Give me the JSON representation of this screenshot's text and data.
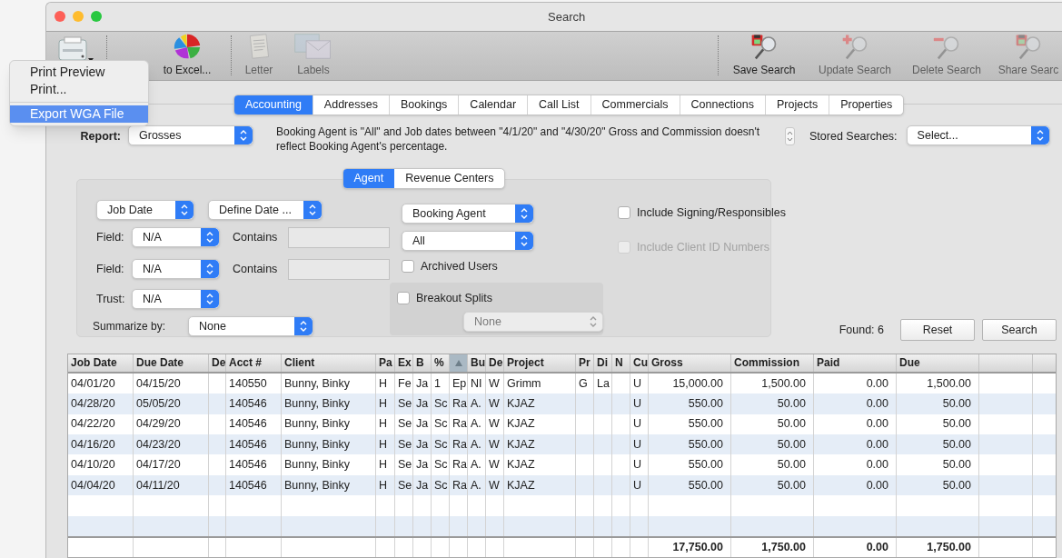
{
  "window": {
    "title": "Search"
  },
  "toolbar": {
    "left": [
      {
        "kind": "printer",
        "has_menu": true
      },
      {
        "kind": "pie-chart",
        "label": "to Excel...",
        "disabled": false
      },
      {
        "kind": "letter",
        "label": "Letter",
        "disabled": true
      },
      {
        "kind": "labels",
        "label": "Labels",
        "disabled": true
      }
    ],
    "right": [
      {
        "kind": "save",
        "label": "Save Search",
        "disabled": false
      },
      {
        "kind": "update",
        "label": "Update Search",
        "disabled": true
      },
      {
        "kind": "delete",
        "label": "Delete Search",
        "disabled": true
      },
      {
        "kind": "share",
        "label": "Share Searc",
        "disabled": true
      }
    ]
  },
  "print_menu": {
    "items": [
      {
        "label": "Print Preview",
        "selected": false
      },
      {
        "label": "Print...",
        "selected": false
      },
      {
        "label": "Export WGA File",
        "selected": true
      }
    ]
  },
  "tabs": [
    {
      "label": "Accounting",
      "selected": true
    },
    {
      "label": "Addresses",
      "selected": false
    },
    {
      "label": "Bookings",
      "selected": false
    },
    {
      "label": "Calendar",
      "selected": false
    },
    {
      "label": "Call List",
      "selected": false
    },
    {
      "label": "Commercials",
      "selected": false
    },
    {
      "label": "Connections",
      "selected": false
    },
    {
      "label": "Projects",
      "selected": false
    },
    {
      "label": "Properties",
      "selected": false
    }
  ],
  "report": {
    "label": "Report:",
    "value": "Grosses"
  },
  "description": "Booking Agent is \"All\" and Job dates between \"4/1/20\" and \"4/30/20\" Gross and Commission doesn't reflect Booking Agent's percentage.",
  "stored_searches": {
    "label": "Stored Searches:",
    "value": "Select..."
  },
  "criteria": {
    "tabs": [
      {
        "label": "Agent",
        "selected": true
      },
      {
        "label": "Revenue Centers",
        "selected": false
      }
    ],
    "date_field": "Job Date",
    "date_range": "Define Date ...",
    "fields": [
      {
        "label": "Field:",
        "value": "N/A",
        "contains_label": "Contains"
      },
      {
        "label": "Field:",
        "value": "N/A",
        "contains_label": "Contains"
      }
    ],
    "trust": {
      "label": "Trust:",
      "value": "N/A"
    },
    "summarize": {
      "label": "Summarize by:",
      "value": "None"
    },
    "agent_type": "Booking Agent",
    "agent": "All",
    "archived_users": {
      "label": "Archived Users",
      "checked": false
    },
    "breakout_splits": {
      "label": "Breakout Splits",
      "checked": false
    },
    "split_select": {
      "value": "None",
      "disabled": true
    },
    "options": [
      {
        "label": "Include Signing/Responsibles",
        "checked": false,
        "disabled": false
      },
      {
        "label": "Include Client ID Numbers",
        "checked": false,
        "disabled": true
      }
    ]
  },
  "found": "Found: 6",
  "buttons": [
    "Reset",
    "Search"
  ],
  "table": {
    "columns": [
      {
        "label": "Job Date",
        "kind": "text"
      },
      {
        "label": "Due Date",
        "kind": "text"
      },
      {
        "label": "De",
        "kind": "text"
      },
      {
        "label": "Acct #",
        "kind": "text"
      },
      {
        "label": "Client",
        "kind": "text"
      },
      {
        "label": "Pa",
        "kind": "text"
      },
      {
        "label": "Ex",
        "kind": "text"
      },
      {
        "label": "B",
        "kind": "text"
      },
      {
        "label": "%",
        "kind": "text"
      },
      {
        "kind": "sort"
      },
      {
        "label": "Bu",
        "kind": "text"
      },
      {
        "label": "De",
        "kind": "text"
      },
      {
        "label": "Project",
        "kind": "text"
      },
      {
        "label": "Pr",
        "kind": "text"
      },
      {
        "label": "Di",
        "kind": "text"
      },
      {
        "label": "N",
        "kind": "text"
      },
      {
        "label": "Cu",
        "kind": "text"
      },
      {
        "label": "Gross",
        "kind": "amount"
      },
      {
        "label": "Commission",
        "kind": "amount"
      },
      {
        "label": "Paid",
        "kind": "amount"
      },
      {
        "label": "Due",
        "kind": "amount"
      },
      {
        "kind": "blank"
      }
    ],
    "rows": [
      [
        "04/01/20",
        "04/15/20",
        null,
        "140550",
        "Bunny, Binky",
        "H",
        "Fe",
        "Ja",
        "1",
        "Ep",
        "NI",
        "W",
        "Grimm",
        "G",
        "La",
        null,
        "U",
        "15,000.00",
        "1,500.00",
        "0.00",
        "1,500.00",
        null
      ],
      [
        "04/28/20",
        "05/05/20",
        null,
        "140546",
        "Bunny, Binky",
        "H",
        "Se",
        "Ja",
        "Sc",
        "Ra",
        "A.",
        "W",
        "KJAZ",
        null,
        null,
        null,
        "U",
        "550.00",
        "50.00",
        "0.00",
        "50.00",
        null
      ],
      [
        "04/22/20",
        "04/29/20",
        null,
        "140546",
        "Bunny, Binky",
        "H",
        "Se",
        "Ja",
        "Sc",
        "Ra",
        "A.",
        "W",
        "KJAZ",
        null,
        null,
        null,
        "U",
        "550.00",
        "50.00",
        "0.00",
        "50.00",
        null
      ],
      [
        "04/16/20",
        "04/23/20",
        null,
        "140546",
        "Bunny, Binky",
        "H",
        "Se",
        "Ja",
        "Sc",
        "Ra",
        "A.",
        "W",
        "KJAZ",
        null,
        null,
        null,
        "U",
        "550.00",
        "50.00",
        "0.00",
        "50.00",
        null
      ],
      [
        "04/10/20",
        "04/17/20",
        null,
        "140546",
        "Bunny, Binky",
        "H",
        "Se",
        "Ja",
        "Sc",
        "Ra",
        "A.",
        "W",
        "KJAZ",
        null,
        null,
        null,
        "U",
        "550.00",
        "50.00",
        "0.00",
        "50.00",
        null
      ],
      [
        "04/04/20",
        "04/11/20",
        null,
        "140546",
        "Bunny, Binky",
        "H",
        "Se",
        "Ja",
        "Sc",
        "Ra",
        "A.",
        "W",
        "KJAZ",
        null,
        null,
        null,
        "U",
        "550.00",
        "50.00",
        "0.00",
        "50.00",
        null
      ]
    ],
    "totals": [
      "17,750.00",
      "1,750.00",
      "0.00",
      "1,750.00"
    ]
  }
}
